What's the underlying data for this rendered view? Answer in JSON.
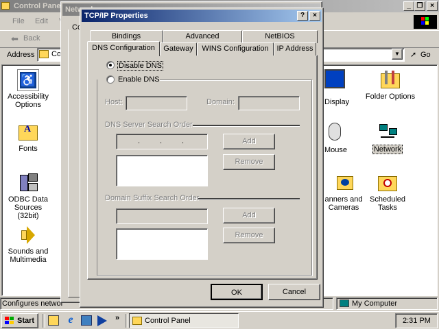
{
  "control_panel": {
    "title": "Control Panel",
    "menu": [
      "File",
      "Edit",
      "V"
    ],
    "back_label": "Back",
    "address_label": "Address",
    "address_value": "Co",
    "go_label": "Go",
    "status_text": "Configures networ",
    "status_right": "My Computer",
    "left_icons": [
      {
        "line1": "Accessibility",
        "line2": "Options"
      },
      {
        "line1": "Fonts",
        "line2": ""
      },
      {
        "line1": "ODBC Data",
        "line2": "Sources (32bit)"
      },
      {
        "line1": "Sounds and",
        "line2": "Multimedia"
      }
    ],
    "right_icons": {
      "display": "Display",
      "folder_options": "Folder Options",
      "mouse": "Mouse",
      "network": "Network",
      "scanners_line1": "anners and",
      "scanners_line2": "Cameras",
      "scheduled_line1": "Scheduled",
      "scheduled_line2": "Tasks"
    }
  },
  "network_window": {
    "title": "Network",
    "partial_label": "Co"
  },
  "dialog": {
    "title": "TCP/IP Properties",
    "help_btn": "?",
    "close_btn": "×",
    "tabs_back": [
      "Bindings",
      "Advanced",
      "NetBIOS"
    ],
    "tabs_front": [
      "DNS Configuration",
      "Gateway",
      "WINS Configuration",
      "IP Address"
    ],
    "active_tab": "DNS Configuration",
    "radio_disable": "Disable DNS",
    "radio_enable": "Enable DNS",
    "host_label": "Host:",
    "domain_label": "Domain:",
    "dns_group": "DNS Server Search Order",
    "suffix_group": "Domain Suffix Search Order",
    "add_label": "Add",
    "remove_label": "Remove",
    "ok_label": "OK",
    "cancel_label": "Cancel"
  },
  "taskbar": {
    "start_label": "Start",
    "task_label": "Control Panel",
    "clock": "2:31 PM",
    "chevron": "»"
  }
}
